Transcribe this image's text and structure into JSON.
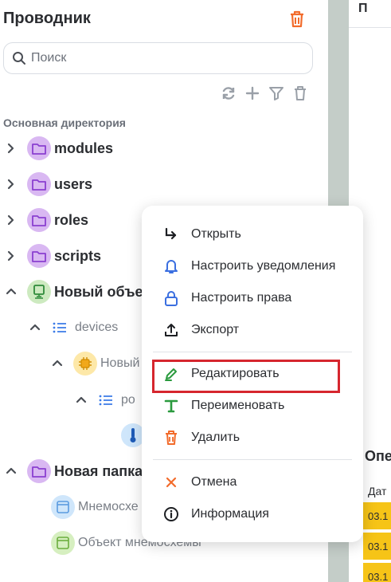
{
  "explorer": {
    "title": "Проводник",
    "search_placeholder": "Поиск",
    "section_label": "Основная директория",
    "tree": [
      {
        "label": "modules"
      },
      {
        "label": "users"
      },
      {
        "label": "roles"
      },
      {
        "label": "scripts"
      },
      {
        "label": "Новый объе"
      },
      {
        "label": "devices"
      },
      {
        "label": "Новый"
      },
      {
        "label": "ро"
      },
      {
        "label": "Новая папка"
      },
      {
        "label": "Мнемосхе"
      },
      {
        "label": "Объект мнемосхемы"
      }
    ]
  },
  "right_panel": {
    "top_label": "П",
    "bottom_header": "Опе",
    "col_header": "Дат",
    "rows": [
      "03.1",
      "03.1",
      "03.1"
    ]
  },
  "context_menu": {
    "items": [
      {
        "label": "Открыть",
        "icon": "arrow-turn-icon"
      },
      {
        "label": "Настроить уведомления",
        "icon": "bell-icon"
      },
      {
        "label": "Настроить права",
        "icon": "lock-icon"
      },
      {
        "label": "Экспорт",
        "icon": "export-icon"
      },
      {
        "label": "Редактировать",
        "icon": "pencil-icon"
      },
      {
        "label": "Переименовать",
        "icon": "text-t-icon"
      },
      {
        "label": "Удалить",
        "icon": "trash-icon"
      },
      {
        "label": "Отмена",
        "icon": "close-icon"
      },
      {
        "label": "Информация",
        "icon": "info-icon"
      }
    ]
  },
  "colors": {
    "accent_orange": "#f26b2b",
    "folder_purple": "#d9b8f2",
    "highlight_red": "#d6262e",
    "table_yellow": "#f6c417"
  }
}
